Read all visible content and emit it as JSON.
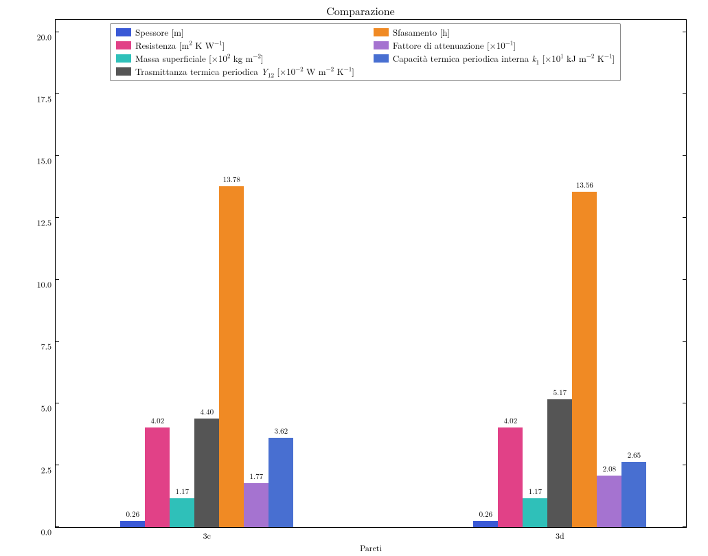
{
  "chart_data": {
    "type": "bar",
    "title": "Comparazione",
    "xlabel": "Pareti",
    "ylabel": "",
    "ylim": [
      0,
      20.5
    ],
    "yticks": [
      0.0,
      2.5,
      5.0,
      7.5,
      10.0,
      12.5,
      15.0,
      17.5,
      20.0
    ],
    "categories": [
      "3c",
      "3d"
    ],
    "series": [
      {
        "name": "Spessore [m]",
        "color": "#3a59d6",
        "values": [
          0.26,
          0.26
        ]
      },
      {
        "name": "Resistenza [m² K W⁻¹]",
        "color": "#e14187",
        "values": [
          4.02,
          4.02
        ]
      },
      {
        "name": "Massa superficiale [×10² kg m⁻²]",
        "color": "#2fc0b9",
        "values": [
          1.17,
          1.17
        ]
      },
      {
        "name": "Trasmittanza termica periodica Y₁₂ [×10⁻² W m⁻² K⁻¹]",
        "color": "#555555",
        "values": [
          4.4,
          5.17
        ]
      },
      {
        "name": "Sfasamento [h]",
        "color": "#f08a24",
        "values": [
          13.78,
          13.56
        ]
      },
      {
        "name": "Fattore di attenuazione [×10⁻¹]",
        "color": "#a573d0",
        "values": [
          1.77,
          2.08
        ]
      },
      {
        "name": "Capacità termica periodica interna k₁ [×10¹ kJ m⁻² K⁻¹]",
        "color": "#486fd1",
        "values": [
          3.62,
          2.65
        ]
      }
    ],
    "legend_columns": [
      [
        "Spessore [m]",
        "Resistenza",
        "Massa superficiale",
        "Trasmittanza termica periodica"
      ],
      [
        "Sfasamento [h]",
        "Fattore di attenuazione",
        "Capacità termica periodica interna"
      ]
    ],
    "legend_labels_html": {
      "s0": "Spessore [m]",
      "s1": "Resistenza [m<sup>2</sup> K W<sup>&minus;1</sup>]",
      "s2": "Massa superficiale [&times;10<sup>2</sup> kg m<sup>&minus;2</sup>]",
      "s3": "Trasmittanza termica periodica <span class='it'>Y</span><sub>12</sub> [&times;10<sup>&minus;2</sup> W m<sup>&minus;2</sup> K<sup>&minus;1</sup>]",
      "s4": "Sfasamento [h]",
      "s5": "Fattore di attenuazione [&times;10<sup>&minus;1</sup>]",
      "s6": "Capacit&agrave; termica periodica interna <span class='it'>k</span><sub>1</sub> [&times;10<sup>1</sup> kJ m<sup>&minus;2</sup> K<sup>&minus;1</sup>]"
    }
  }
}
